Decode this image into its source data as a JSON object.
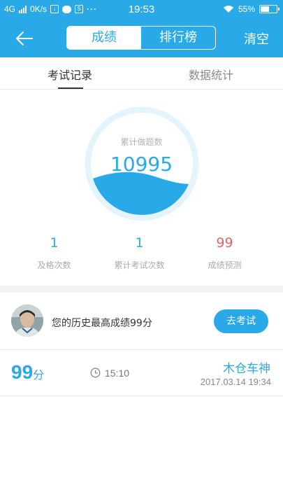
{
  "status_bar": {
    "network": "4G",
    "speed": "0K/s",
    "time": "19:53",
    "battery": "55%",
    "battery_level": 0.55,
    "icons": [
      "signal-icon",
      "download-icon",
      "chat-icon",
      "s-icon",
      "more-icon",
      "wifi-icon",
      "battery-icon"
    ]
  },
  "header": {
    "tabs": [
      {
        "label": "成绩",
        "active": true
      },
      {
        "label": "排行榜",
        "active": false
      }
    ],
    "clear_label": "清空"
  },
  "sub_tabs": [
    {
      "label": "考试记录",
      "active": true
    },
    {
      "label": "数据统计",
      "active": false
    }
  ],
  "gauge": {
    "label": "累计做题数",
    "value": "10995"
  },
  "stats": [
    {
      "value": "1",
      "label": "及格次数"
    },
    {
      "value": "1",
      "label": "累计考试次数"
    },
    {
      "value": "99",
      "label": "成绩预测"
    }
  ],
  "best": {
    "text": "您的历史最高成绩99分",
    "button_label": "去考试"
  },
  "records": [
    {
      "score": "99",
      "unit": "分",
      "time": "15:10",
      "title": "木仓车神",
      "date": "2017.03.14  19:34"
    }
  ],
  "colors": {
    "accent": "#29a9e8",
    "prediction": "#e06666",
    "gauge_ring": "#e3f4fd"
  }
}
